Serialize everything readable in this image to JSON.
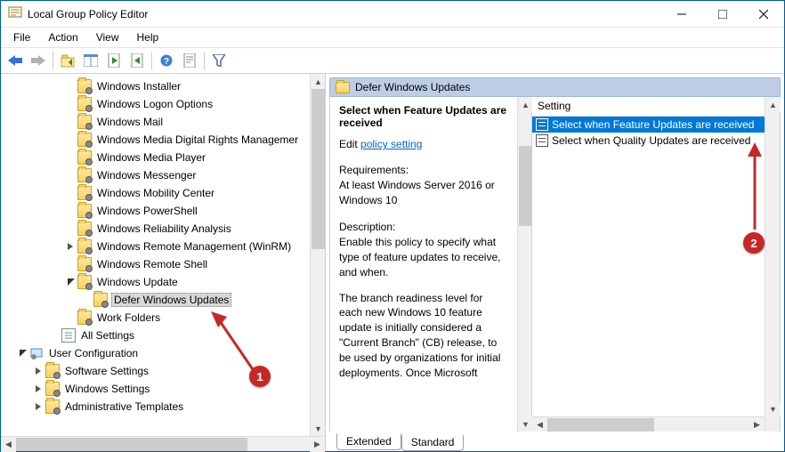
{
  "window": {
    "title": "Local Group Policy Editor"
  },
  "menubar": [
    "File",
    "Action",
    "View",
    "Help"
  ],
  "toolbar_icons": [
    "back",
    "forward",
    "up",
    "console",
    "refresh",
    "export",
    "help",
    "properties",
    "filter"
  ],
  "tree": {
    "visible_items": [
      {
        "depth": 4,
        "folder": true,
        "label": "Windows Installer"
      },
      {
        "depth": 4,
        "folder": true,
        "label": "Windows Logon Options"
      },
      {
        "depth": 4,
        "folder": true,
        "label": "Windows Mail"
      },
      {
        "depth": 4,
        "folder": true,
        "label": "Windows Media Digital Rights Managemer"
      },
      {
        "depth": 4,
        "folder": true,
        "label": "Windows Media Player"
      },
      {
        "depth": 4,
        "folder": true,
        "label": "Windows Messenger"
      },
      {
        "depth": 4,
        "folder": true,
        "label": "Windows Mobility Center"
      },
      {
        "depth": 4,
        "folder": true,
        "label": "Windows PowerShell"
      },
      {
        "depth": 4,
        "folder": true,
        "label": "Windows Reliability Analysis"
      },
      {
        "depth": 4,
        "folder": true,
        "expander": ">",
        "label": "Windows Remote Management (WinRM)"
      },
      {
        "depth": 4,
        "folder": true,
        "label": "Windows Remote Shell"
      },
      {
        "depth": 4,
        "folder": true,
        "expander": "v",
        "label": "Windows Update"
      },
      {
        "depth": 5,
        "folder": true,
        "label": "Defer Windows Updates",
        "selected": true
      },
      {
        "depth": 4,
        "folder": true,
        "label": "Work Folders"
      },
      {
        "depth": 3,
        "folder": false,
        "icon": "settings",
        "label": "All Settings"
      },
      {
        "depth": 1,
        "folder": false,
        "expander": "v",
        "icon": "user-config",
        "label": "User Configuration"
      },
      {
        "depth": 2,
        "folder": true,
        "expander": ">",
        "label": "Software Settings"
      },
      {
        "depth": 2,
        "folder": true,
        "expander": ">",
        "label": "Windows Settings"
      },
      {
        "depth": 2,
        "folder": true,
        "expander": ">",
        "label": "Administrative Templates"
      }
    ]
  },
  "right": {
    "header": "Defer Windows Updates",
    "detail_title": "Select when Feature Updates are received",
    "edit_prefix": "Edit ",
    "edit_link": "policy setting ",
    "requirements_label": "Requirements:",
    "requirements_text": "At least Windows Server 2016 or Windows 10",
    "description_label": "Description:",
    "description_p1": "Enable this policy to specify what type of feature updates to receive, and when.",
    "description_p2": "The branch readiness level for each new Windows 10 feature update is initially considered a \"Current Branch\" (CB) release, to be used by organizations for initial deployments. Once Microsoft",
    "list_header": "Setting",
    "list_rows": [
      {
        "label": "Select when Feature Updates are received",
        "selected": true
      },
      {
        "label": "Select when Quality Updates are received",
        "selected": false
      }
    ]
  },
  "tabs": [
    "Extended",
    "Standard"
  ],
  "annotations": {
    "badge1": "1",
    "badge2": "2"
  }
}
